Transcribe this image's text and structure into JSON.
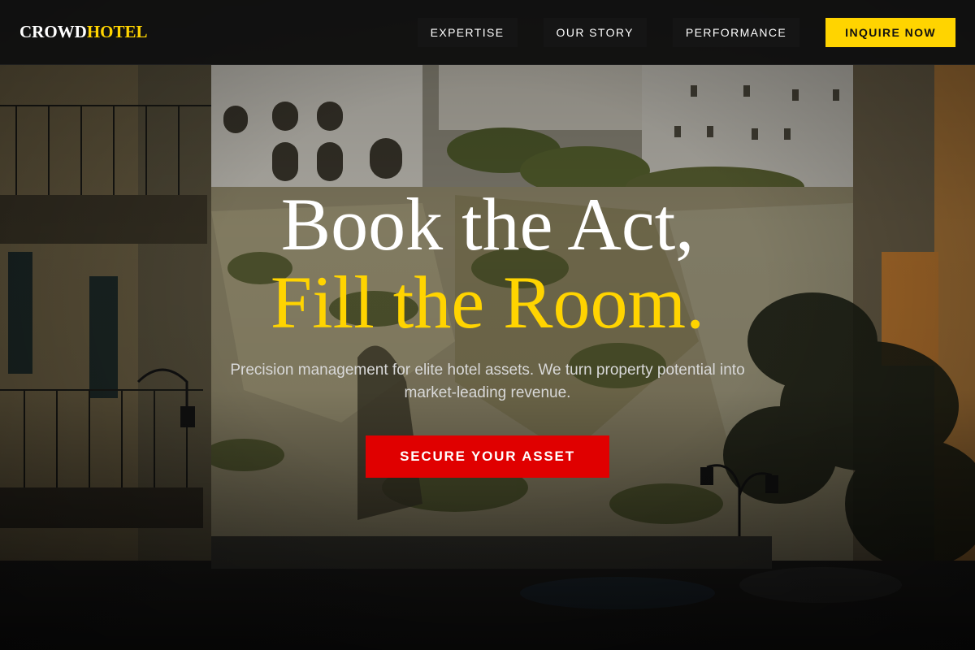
{
  "brand": {
    "logo_part1": "CROWD",
    "logo_part2": "HOTEL",
    "accent_color": "#ffd400"
  },
  "nav": {
    "items": [
      {
        "label": "EXPERTISE"
      },
      {
        "label": "OUR STORY"
      },
      {
        "label": "PERFORMANCE"
      }
    ],
    "cta_label": "INQUIRE NOW"
  },
  "hero": {
    "headline_line1": "Book the Act,",
    "headline_line2": "Fill the Room.",
    "subtext": "Precision management for elite hotel assets. We turn property potential into market-leading revenue.",
    "cta_label": "SECURE YOUR ASSET",
    "cta_color": "#e00000",
    "background_image": "coastal-hillside-village-photo"
  }
}
